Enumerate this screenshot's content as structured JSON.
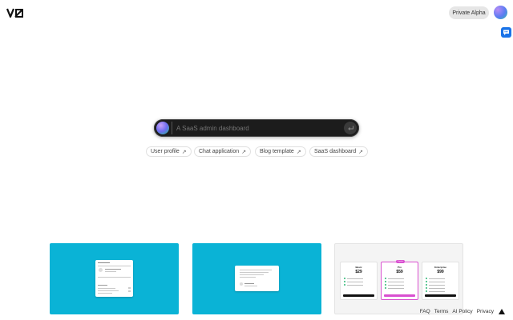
{
  "header": {
    "logo_text": "V0",
    "alpha_label": "Private Alpha"
  },
  "prompt": {
    "placeholder": "A SaaS admin dashboard",
    "value": ""
  },
  "suggestions": [
    {
      "label": "User profile"
    },
    {
      "label": "Chat application"
    },
    {
      "label": "Blog template"
    },
    {
      "label": "SaaS dashboard"
    }
  ],
  "cards": [
    {
      "background": "#0ab3d6"
    },
    {
      "background": "#0ab3d6"
    },
    {
      "background": "#f4f4f4",
      "plans": [
        {
          "name": "Basic",
          "price": "$29"
        },
        {
          "name": "Pro",
          "price": "$59",
          "badge": "Popular"
        },
        {
          "name": "Enterprise",
          "price": "$99"
        }
      ]
    }
  ],
  "footer": {
    "links": [
      "FAQ",
      "Terms",
      "AI Policy",
      "Privacy"
    ]
  },
  "colors": {
    "accent": "#0ab3d6",
    "pro_button": "#d94fd0",
    "chat_extension": "#1a73e8"
  }
}
